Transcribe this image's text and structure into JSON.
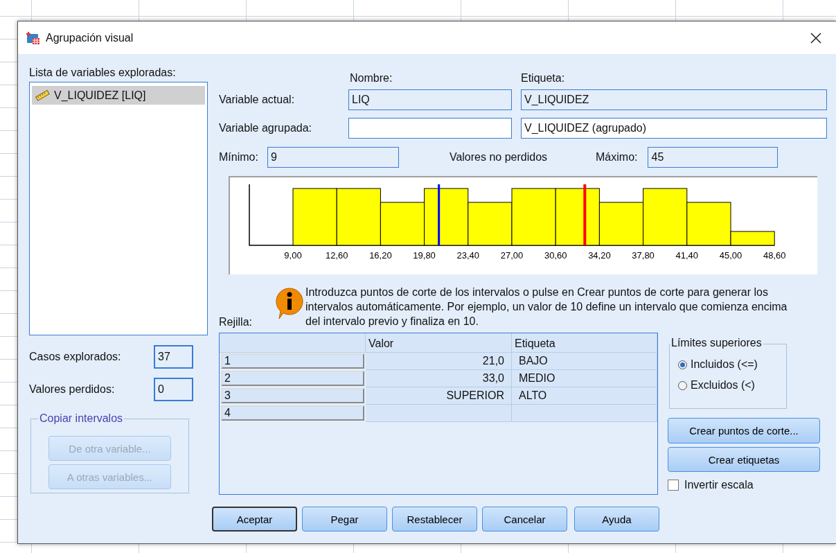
{
  "window": {
    "title": "Agrupación visual"
  },
  "variable_list": {
    "label": "Lista de variables exploradas:",
    "items": [
      {
        "label": "V_LIQUIDEZ [LIQ]",
        "selected": true
      }
    ]
  },
  "cases_scanned": {
    "label": "Casos explorados:",
    "value": "37"
  },
  "missing_values": {
    "label": "Valores perdidos:",
    "value": "0"
  },
  "copy_intervals": {
    "title": "Copiar intervalos",
    "buttons": [
      {
        "label": "De otra variable...",
        "disabled": true
      },
      {
        "label": "A otras variables...",
        "disabled": true
      }
    ]
  },
  "headings": {
    "name": "Nombre:",
    "label": "Etiqueta:"
  },
  "current_variable": {
    "label": "Variable actual:",
    "name": "LIQ",
    "var_label": "V_LIQUIDEZ"
  },
  "binned_variable": {
    "label": "Variable agrupada:",
    "var_label": "V_LIQUIDEZ (agrupado)"
  },
  "minimum": {
    "label": "Mínimo:",
    "value": "9"
  },
  "nonmissing_label": "Valores no perdidos",
  "maximum": {
    "label": "Máximo:",
    "value": "45"
  },
  "histogram": {
    "x_ticks": [
      "9,00",
      "12,60",
      "16,20",
      "19,80",
      "23,40",
      "27,00",
      "30,60",
      "34,20",
      "37,80",
      "41,40",
      "45,00",
      "48,60"
    ]
  },
  "info_text": "Introduzca puntos de corte de los intervalos o pulse en Crear puntos de corte para generar los intervalos automáticamente. Por ejemplo, un valor de 10 define un intervalo que comienza encima del intervalo previo y finaliza en 10.",
  "grid": {
    "label": "Rejilla:",
    "columns": [
      "Valor",
      "Etiqueta"
    ],
    "rows": [
      {
        "index": "1",
        "value": "21,0",
        "label": "BAJO"
      },
      {
        "index": "2",
        "value": "33,0",
        "label": "MEDIO"
      },
      {
        "index": "3",
        "value": "SUPERIOR",
        "label": "ALTO"
      },
      {
        "index": "4"
      }
    ]
  },
  "upper_limits": {
    "title": "Límites superiores",
    "options": [
      {
        "label": "Incluidos (<=)",
        "selected": true
      },
      {
        "label": "Excluidos (<)",
        "selected": false
      }
    ]
  },
  "make_cutpoints_button": "Crear puntos de corte...",
  "make_labels_button": "Crear etiquetas",
  "reverse_scale": {
    "label": "Invertir escala",
    "checked": false
  },
  "buttons": [
    {
      "label": "Aceptar",
      "default": true
    },
    {
      "label": "Pegar",
      "default": false
    },
    {
      "label": "Restablecer",
      "default": false
    },
    {
      "label": "Cancelar",
      "default": false
    },
    {
      "label": "Ayuda",
      "default": false
    }
  ]
}
